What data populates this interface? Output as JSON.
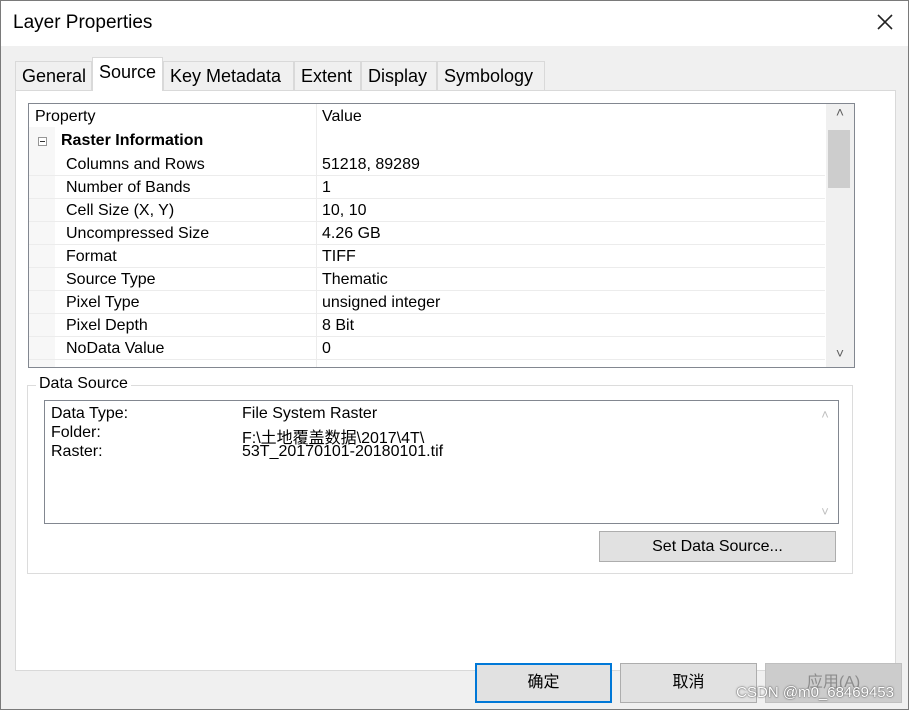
{
  "window": {
    "title": "Layer Properties",
    "close_icon": "close-icon"
  },
  "tabs": [
    {
      "label": "General",
      "active": false
    },
    {
      "label": "Source",
      "active": true
    },
    {
      "label": "Key Metadata",
      "active": false
    },
    {
      "label": "Extent",
      "active": false
    },
    {
      "label": "Display",
      "active": false
    },
    {
      "label": "Symbology",
      "active": false
    }
  ],
  "grid": {
    "headers": {
      "property": "Property",
      "value": "Value"
    },
    "category": "Raster Information",
    "rows": [
      {
        "key": "Columns and Rows",
        "value": "51218, 89289"
      },
      {
        "key": "Number of Bands",
        "value": "1"
      },
      {
        "key": "Cell Size (X, Y)",
        "value": "10, 10"
      },
      {
        "key": "Uncompressed Size",
        "value": "4.26 GB"
      },
      {
        "key": "Format",
        "value": "TIFF"
      },
      {
        "key": "Source Type",
        "value": "Thematic"
      },
      {
        "key": "Pixel Type",
        "value": "unsigned integer"
      },
      {
        "key": "Pixel Depth",
        "value": "8 Bit"
      },
      {
        "key": "NoData Value",
        "value": "0"
      }
    ]
  },
  "data_source": {
    "legend": "Data Source",
    "lines": [
      {
        "key": "Data Type:",
        "value": "File System Raster"
      },
      {
        "key": "Folder:",
        "value": "F:\\土地覆盖数据\\2017\\4T\\"
      },
      {
        "key": "Raster:",
        "value": "53T_20170101-20180101.tif"
      }
    ],
    "set_button": "Set Data Source..."
  },
  "footer": {
    "ok": "确定",
    "cancel": "取消",
    "apply": "应用(A)"
  },
  "watermark": "CSDN @m0_68469453"
}
